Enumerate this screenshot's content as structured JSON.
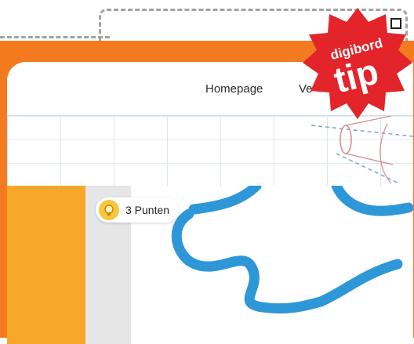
{
  "nav": {
    "home_label": "Homepage",
    "next_label": "Ve"
  },
  "score": {
    "label": "3 Punten"
  },
  "badge_brand": {
    "line1": "digibord",
    "line2": "tip"
  },
  "colors": {
    "frame_orange": "#f47a20",
    "sidebar_orange": "#f9a72a",
    "river_blue": "#2e97d8",
    "badge_red": "#e3242b"
  },
  "icons": {
    "score": "lightbulb-icon",
    "corner": "square-handle-icon"
  }
}
